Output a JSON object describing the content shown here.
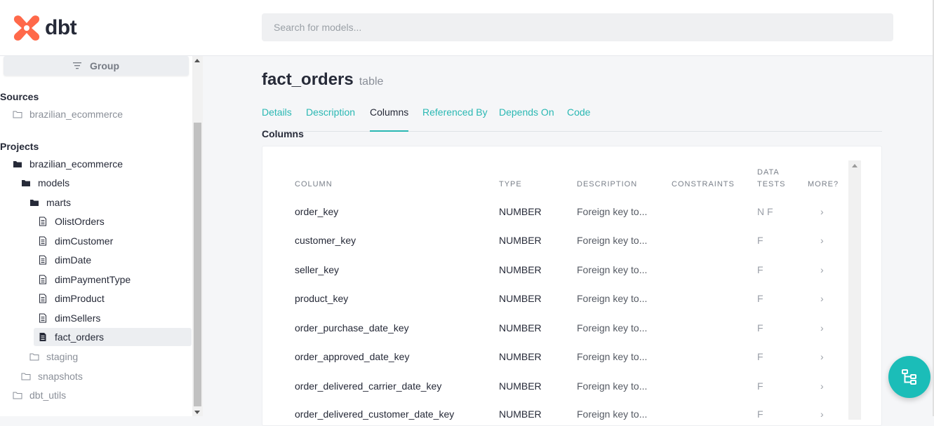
{
  "header": {
    "logo_text": "dbt",
    "search_placeholder": "Search for models..."
  },
  "sidebar": {
    "group_button": "Group",
    "sources_title": "Sources",
    "sources": [
      {
        "label": "brazilian_ecommerce"
      }
    ],
    "projects_title": "Projects",
    "projects": [
      {
        "label": "brazilian_ecommerce",
        "type": "folder-open"
      },
      {
        "label": "models",
        "type": "folder-open"
      },
      {
        "label": "marts",
        "type": "folder-open"
      },
      {
        "label": "OlistOrders",
        "type": "file"
      },
      {
        "label": "dimCustomer",
        "type": "file"
      },
      {
        "label": "dimDate",
        "type": "file"
      },
      {
        "label": "dimPaymentType",
        "type": "file"
      },
      {
        "label": "dimProduct",
        "type": "file"
      },
      {
        "label": "dimSellers",
        "type": "file"
      },
      {
        "label": "fact_orders",
        "type": "file-active"
      },
      {
        "label": "staging",
        "type": "folder"
      },
      {
        "label": "snapshots",
        "type": "folder"
      },
      {
        "label": "dbt_utils",
        "type": "folder"
      }
    ]
  },
  "main": {
    "title": "fact_orders",
    "title_type": "table",
    "tabs": [
      "Details",
      "Description",
      "Columns",
      "Referenced By",
      "Depends On",
      "Code"
    ],
    "active_tab": "Columns",
    "section_label": "Columns",
    "table": {
      "headers": [
        "Column",
        "Type",
        "Description",
        "Constraints",
        "Data Tests",
        "More?"
      ],
      "rows": [
        {
          "column": "order_key",
          "type": "NUMBER",
          "description": "Foreign key to...",
          "constraints": "",
          "tests": "N F",
          "more": "›"
        },
        {
          "column": "customer_key",
          "type": "NUMBER",
          "description": "Foreign key to...",
          "constraints": "",
          "tests": "F",
          "more": "›"
        },
        {
          "column": "seller_key",
          "type": "NUMBER",
          "description": "Foreign key to...",
          "constraints": "",
          "tests": "F",
          "more": "›"
        },
        {
          "column": "product_key",
          "type": "NUMBER",
          "description": "Foreign key to...",
          "constraints": "",
          "tests": "F",
          "more": "›"
        },
        {
          "column": "order_purchase_date_key",
          "type": "NUMBER",
          "description": "Foreign key to...",
          "constraints": "",
          "tests": "F",
          "more": "›"
        },
        {
          "column": "order_approved_date_key",
          "type": "NUMBER",
          "description": "Foreign key to...",
          "constraints": "",
          "tests": "F",
          "more": "›"
        },
        {
          "column": "order_delivered_carrier_date_key",
          "type": "NUMBER",
          "description": "Foreign key to...",
          "constraints": "",
          "tests": "F",
          "more": "›"
        },
        {
          "column": "order_delivered_customer_date_key",
          "type": "NUMBER",
          "description": "Foreign key to...",
          "constraints": "",
          "tests": "F",
          "more": "›"
        }
      ]
    }
  },
  "colors": {
    "accent": "#2ab8b3",
    "brand": "#ff694a",
    "fab": "#1bbdb8"
  },
  "icons": {
    "fab": "lineage-graph-icon",
    "group": "filter-lines-icon"
  }
}
